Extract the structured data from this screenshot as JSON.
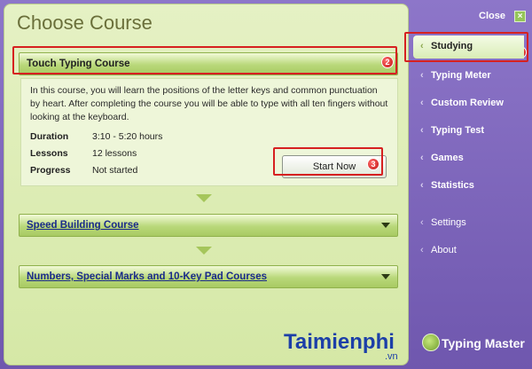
{
  "window": {
    "title": "Choose Course"
  },
  "courses": [
    {
      "title": "Touch Typing Course",
      "description": "In this course, you will learn the positions of the letter keys and common punctuation by heart. After completing the course you will be able to type with all ten fingers without looking at the keyboard.",
      "duration_label": "Duration",
      "duration_value": "3:10 - 5:20 hours",
      "lessons_label": "Lessons",
      "lessons_value": "12 lessons",
      "progress_label": "Progress",
      "progress_value": "Not started",
      "start_button": "Start Now"
    },
    {
      "title": "Speed Building Course"
    },
    {
      "title": "Numbers, Special Marks and 10-Key Pad Courses"
    }
  ],
  "sidebar": {
    "close_label": "Close",
    "items": [
      {
        "label": "Studying",
        "active": true
      },
      {
        "label": "Typing Meter"
      },
      {
        "label": "Custom Review"
      },
      {
        "label": "Typing Test"
      },
      {
        "label": "Games"
      },
      {
        "label": "Statistics"
      },
      {
        "label": "Settings"
      },
      {
        "label": "About"
      }
    ]
  },
  "annotations": {
    "badge1": "1",
    "badge2": "2",
    "badge3": "3"
  },
  "branding": {
    "product": "Typing Master",
    "watermark": "Taimienphi",
    "watermark_sub": ".vn"
  },
  "colors": {
    "highlight": "#d62020",
    "panel": "#e5f1c4",
    "sidebar": "#7b62b8"
  }
}
